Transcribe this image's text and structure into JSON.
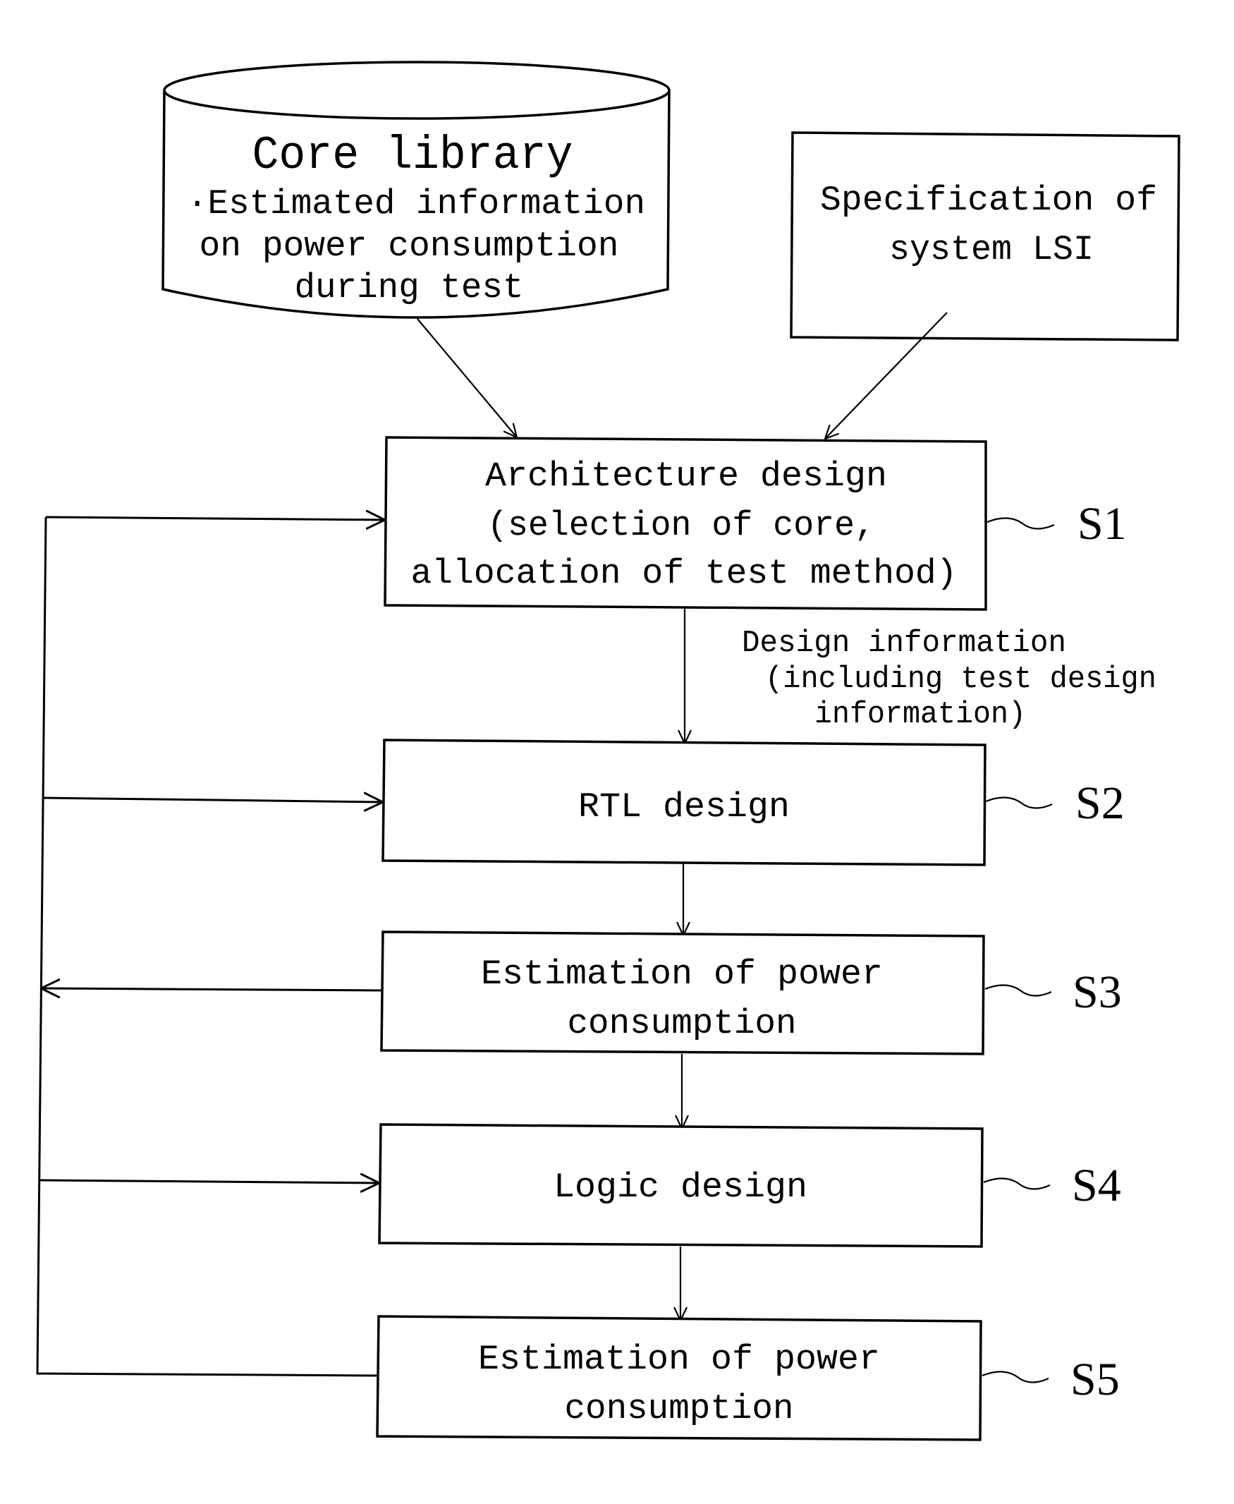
{
  "figure": {
    "type": "flowchart",
    "inputs": {
      "core_library": {
        "shape": "database-cylinder",
        "title": "Core library",
        "lines": [
          "·Estimated information",
          "on power consumption",
          "during test"
        ]
      },
      "specification": {
        "shape": "rectangle",
        "lines": [
          "Specification of",
          "system LSI"
        ]
      }
    },
    "steps": [
      {
        "id": "S1",
        "label": "S1",
        "lines": [
          "Architecture design",
          "(selection of core,",
          "allocation of test method)"
        ]
      },
      {
        "id": "S2",
        "label": "S2",
        "lines": [
          "RTL design"
        ]
      },
      {
        "id": "S3",
        "label": "S3",
        "lines": [
          "Estimation of power",
          "consumption"
        ]
      },
      {
        "id": "S4",
        "label": "S4",
        "lines": [
          "Logic design"
        ]
      },
      {
        "id": "S5",
        "label": "S5",
        "lines": [
          "Estimation of power",
          "consumption"
        ]
      }
    ],
    "edge_annotation": {
      "between": [
        "S1",
        "S2"
      ],
      "lines": [
        "Design information",
        "(including test design",
        "information)"
      ]
    },
    "edges": [
      {
        "from": "core_library",
        "to": "S1"
      },
      {
        "from": "specification",
        "to": "S1"
      },
      {
        "from": "S1",
        "to": "S2"
      },
      {
        "from": "S2",
        "to": "S3"
      },
      {
        "from": "S3",
        "to": "S4"
      },
      {
        "from": "S4",
        "to": "S5"
      },
      {
        "from": "S3",
        "to": "feedback-bus"
      },
      {
        "from": "S5",
        "to": "feedback-bus"
      },
      {
        "from": "feedback-bus",
        "to": "S1"
      },
      {
        "from": "feedback-bus",
        "to": "S2"
      },
      {
        "from": "feedback-bus",
        "to": "S4"
      }
    ]
  }
}
